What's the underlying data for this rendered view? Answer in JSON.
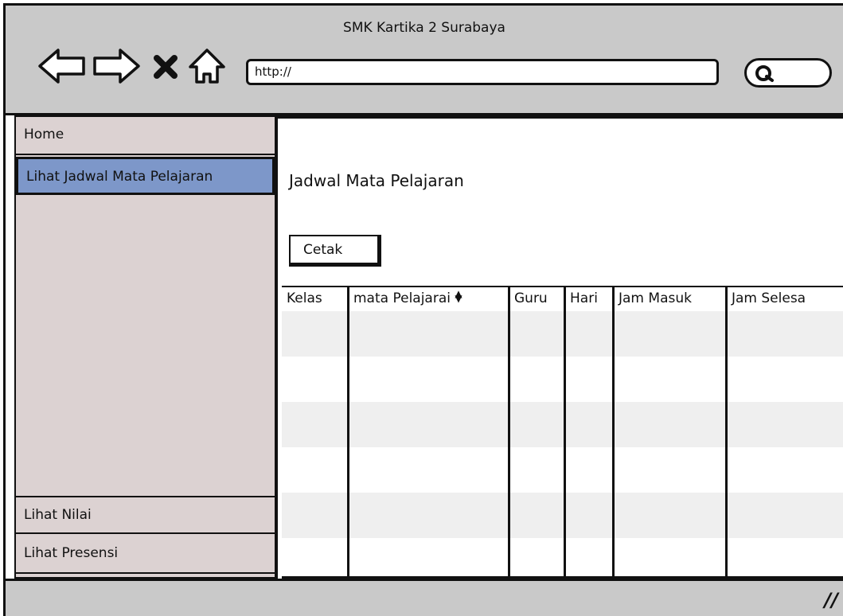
{
  "window": {
    "title": "SMK Kartika 2 Surabaya"
  },
  "toolbar": {
    "back_icon": "back-arrow-icon",
    "forward_icon": "forward-arrow-icon",
    "stop_icon": "close-icon",
    "home_icon": "home-icon",
    "url_value": "http://",
    "search_icon": "search-icon"
  },
  "sidebar": {
    "items": [
      {
        "label": "Home"
      },
      {
        "label": "Lihat Jadwal Mata Pelajaran"
      },
      {
        "label": "Lihat Nilai"
      },
      {
        "label": "Lihat Presensi"
      }
    ],
    "selected": "Lihat Jadwal Mata Pelajaran"
  },
  "main": {
    "title": "Jadwal Mata Pelajaran",
    "print_button": "Cetak",
    "table": {
      "columns": [
        "Kelas",
        "mata Pelajarai",
        "Guru",
        "Hari",
        "Jam Masuk",
        "Jam Selesa"
      ],
      "sort_icon": "sort-icon",
      "rows": []
    }
  },
  "statusbar": {
    "resize_icon": "resize-grip-icon"
  }
}
